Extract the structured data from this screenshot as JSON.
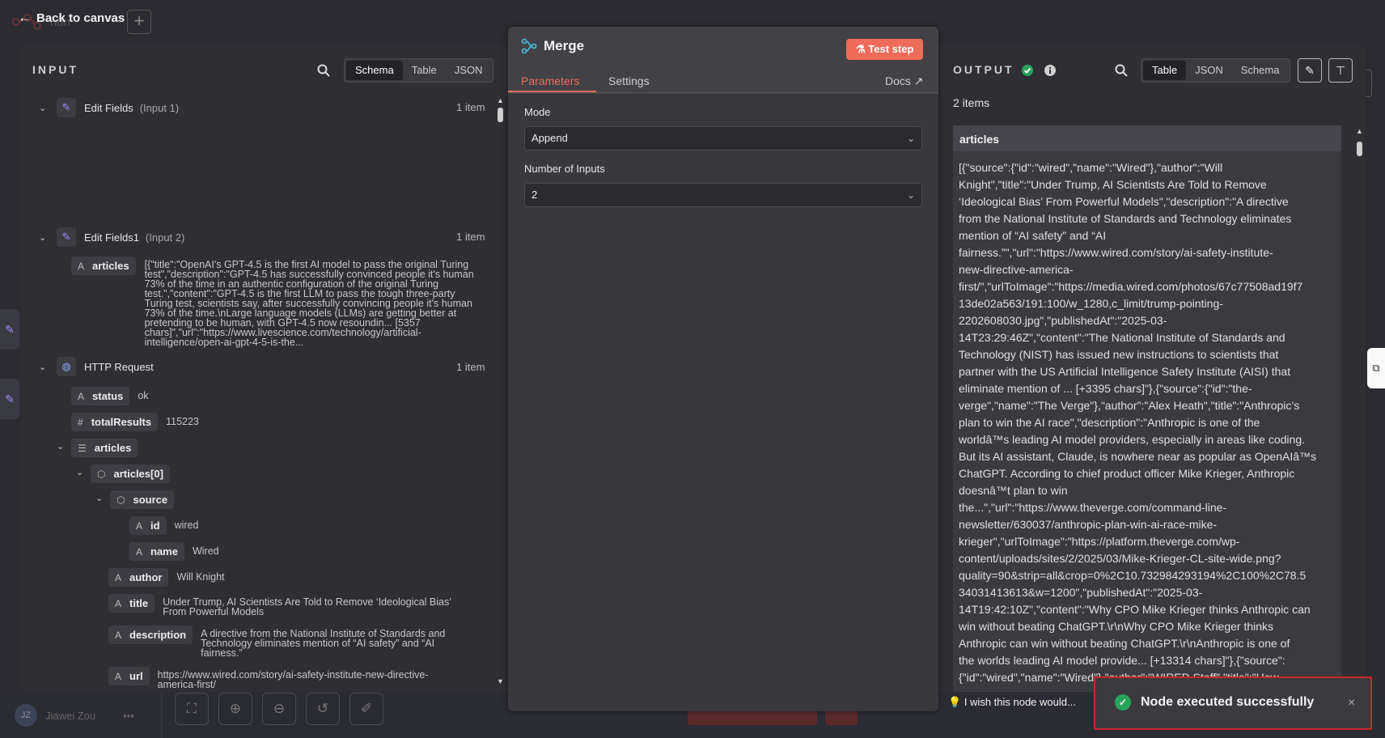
{
  "topbar": {
    "back_label": "Back to canvas",
    "plus": "+"
  },
  "bg": {
    "user_initials": "JZ",
    "user_name": "Jiawei Zou",
    "dots": "•••",
    "workflow_name": "n8n"
  },
  "input": {
    "title": "INPUT",
    "view_tabs": [
      "Schema",
      "Table",
      "JSON"
    ],
    "active_tab": "Schema",
    "nodes": [
      {
        "name": "Edit Fields",
        "sub": "(Input 1)",
        "count": "1 item"
      },
      {
        "name": "Edit Fields1",
        "sub": "(Input 2)",
        "count": "1 item"
      },
      {
        "name": "HTTP Request",
        "sub": "",
        "count": "1 item"
      }
    ],
    "ef1_articles_key": "articles",
    "ef1_articles_type": "A",
    "ef1_articles_value_lines": [
      "[{\"title\":\"OpenAI's GPT-4.5 is the first AI model to pass the original Turing",
      "test\",\"description\":\"GPT-4.5 has successfully convinced people it's human",
      "73% of the time in an authentic configuration of the original Turing",
      "test.\",\"content\":\"GPT-4.5 is the first LLM to pass the tough three-party",
      "Turing test, scientists say, after successfully convincing people it's human",
      "73% of the time.\\nLarge language models (LLMs) are getting better at",
      "pretending to be human, with GPT-4.5 now resoundin... [5357",
      "chars]\",\"url\":\"https://www.livescience.com/technology/artificial-",
      "intelligence/open-ai-gpt-4-5-is-the..."
    ],
    "http_fields": {
      "status": {
        "key": "status",
        "type": "A",
        "value": "ok"
      },
      "totalResults": {
        "key": "totalResults",
        "type": "#",
        "value": "115223"
      },
      "articles": {
        "key": "articles",
        "type": "☰"
      },
      "articles0": {
        "key": "articles[0]",
        "type": "⬡"
      },
      "source": {
        "key": "source",
        "type": "⬡"
      },
      "id": {
        "key": "id",
        "type": "A",
        "value": "wired"
      },
      "name": {
        "key": "name",
        "type": "A",
        "value": "Wired"
      },
      "author": {
        "key": "author",
        "type": "A",
        "value": "Will Knight"
      },
      "title": {
        "key": "title",
        "type": "A",
        "value_lines": [
          "Under Trump, AI Scientists Are Told to Remove ‘Ideological Bias’",
          "From Powerful Models"
        ]
      },
      "description": {
        "key": "description",
        "type": "A",
        "value_lines": [
          "A directive from the National Institute of Standards and",
          "Technology eliminates mention of “AI safety” and “AI",
          "fairness.”"
        ]
      },
      "url": {
        "key": "url",
        "type": "A",
        "value_lines": [
          "https://www.wired.com/story/ai-safety-institute-new-directive-",
          "america-first/"
        ]
      }
    }
  },
  "center": {
    "title": "Merge",
    "test_step": "Test step",
    "tabs": [
      "Parameters",
      "Settings"
    ],
    "docs": "Docs",
    "mode_label": "Mode",
    "mode_value": "Append",
    "inputs_label": "Number of Inputs",
    "inputs_value": "2"
  },
  "output": {
    "title": "OUTPUT",
    "view_tabs": [
      "Table",
      "JSON",
      "Schema"
    ],
    "active_tab": "Table",
    "items": "2 items",
    "column": "articles",
    "cell_lines": [
      "[{\"source\":{\"id\":\"wired\",\"name\":\"Wired\"},\"author\":\"Will",
      "Knight\",\"title\":\"Under Trump, AI Scientists Are Told to Remove",
      "‘Ideological Bias’ From Powerful Models\",\"description\":\"A directive",
      "from the National Institute of Standards and Technology eliminates",
      "mention of “AI safety” and “AI",
      "fairness.”\",\"url\":\"https://www.wired.com/story/ai-safety-institute-",
      "new-directive-america-",
      "first/\",\"urlToImage\":\"https://media.wired.com/photos/67c77508ad19f7",
      "13de02a563/191:100/w_1280,c_limit/trump-pointing-",
      "2202608030.jpg\",\"publishedAt\":\"2025-03-",
      "14T23:29:46Z\",\"content\":\"The National Institute of Standards and",
      "Technology (NIST) has issued new instructions to scientists that",
      "partner with the US Artificial Intelligence Safety Institute (AISI) that",
      "eliminate mention of ... [+3395 chars]\"},{\"source\":{\"id\":\"the-",
      "verge\",\"name\":\"The Verge\"},\"author\":\"Alex Heath\",\"title\":\"Anthropic’s",
      "plan to win the AI race\",\"description\":\"Anthropic is one of the",
      "worldâ™s leading AI model providers, especially in areas like coding.",
      "But its AI assistant, Claude, is nowhere near as popular as OpenAIâ™s",
      "ChatGPT. According to chief product officer Mike Krieger, Anthropic",
      "doesnâ™t plan to win",
      "the...\",\"url\":\"https://www.theverge.com/command-line-",
      "newsletter/630037/anthropic-plan-win-ai-race-mike-",
      "krieger\",\"urlToImage\":\"https://platform.theverge.com/wp-",
      "content/uploads/sites/2/2025/03/Mike-Krieger-CL-site-wide.png?",
      "quality=90&strip=all&crop=0%2C10.732984293194%2C100%2C78.5",
      "34031413613&w=1200\",\"publishedAt\":\"2025-03-",
      "14T19:42:10Z\",\"content\":\"Why CPO Mike Krieger thinks Anthropic can",
      "win without beating ChatGPT.\\r\\nWhy CPO Mike Krieger thinks",
      "Anthropic can win without beating ChatGPT.\\r\\nAnthropic is one of",
      "the worlds leading AI model provide... [+13314 chars]\"},{\"source\":",
      "{\"id\":\"wired\",\"name\":\"Wired\"},\"author\":\"WIRED Staff\",\"title\":\"How"
    ]
  },
  "feedback": "I wish this node would...",
  "toast": {
    "message": "Node executed successfully",
    "close": "×"
  },
  "colors": {
    "accent": "#ef6b5a",
    "success": "#27a35a",
    "toast_border": "#d0242a"
  }
}
